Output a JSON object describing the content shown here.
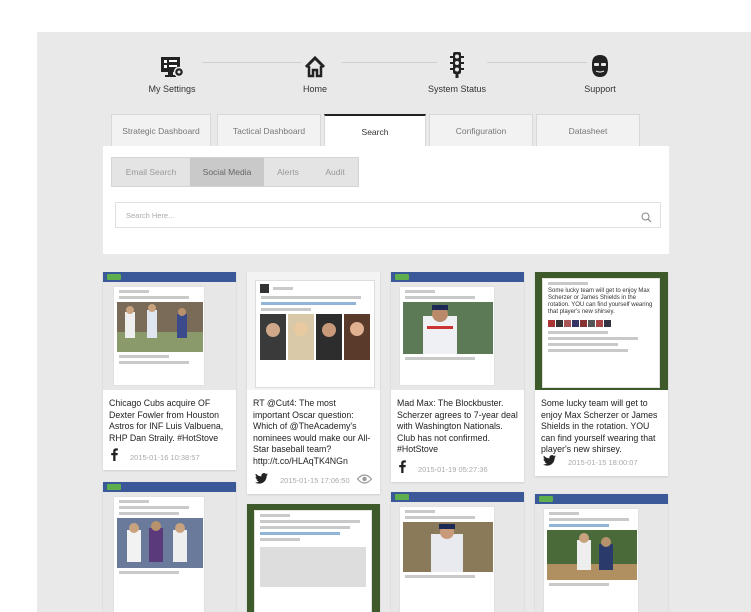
{
  "nav": [
    {
      "label": "My Settings",
      "icon": "settings-monitor-icon"
    },
    {
      "label": "Home",
      "icon": "home-icon"
    },
    {
      "label": "System Status",
      "icon": "traffic-light-icon"
    },
    {
      "label": "Support",
      "icon": "support-person-icon"
    }
  ],
  "tabs": [
    {
      "label": "Strategic Dashboard"
    },
    {
      "label": "Tactical Dashboard"
    },
    {
      "label": "Search",
      "active": true
    },
    {
      "label": "Configuration"
    },
    {
      "label": "Datasheet"
    }
  ],
  "subtabs": [
    {
      "label": "Email Search"
    },
    {
      "label": "Social Media",
      "active": true
    },
    {
      "label": "Alerts"
    },
    {
      "label": "Audit"
    }
  ],
  "search": {
    "placeholder": "Search Here..."
  },
  "cards": [
    {
      "caption": "Chicago Cubs acquire OF Dexter Fowler from Houston Astros for INF Luis Valbuena, RHP Dan Straily. #HotStove",
      "source": "facebook",
      "date": "2015-01-16 10:38:57"
    },
    {
      "caption": "RT @Cut4: The most important Oscar question: Which of @TheAcademy's nominees would make our All-Star baseball team? http://t.co/HLAqTK4NGn",
      "source": "twitter",
      "date": "2015-01-15 17:06:50"
    },
    {
      "caption": "Mad Max: The Blockbuster. Scherzer agrees to 7-year deal with Washington Nationals. Club has not confirmed. #HotStove",
      "source": "facebook",
      "date": "2015-01-19 05:27:36"
    },
    {
      "caption": "Some lucky team will get to enjoy Max Scherzer or James Shields in the rotation. YOU can find yourself wearing that player's new shirsey.",
      "source": "twitter",
      "date": "2015-01-15 18:00:07"
    }
  ],
  "colors": {
    "facebook": "#3b5998",
    "accent": "#222222",
    "green": "#5fae4e"
  }
}
